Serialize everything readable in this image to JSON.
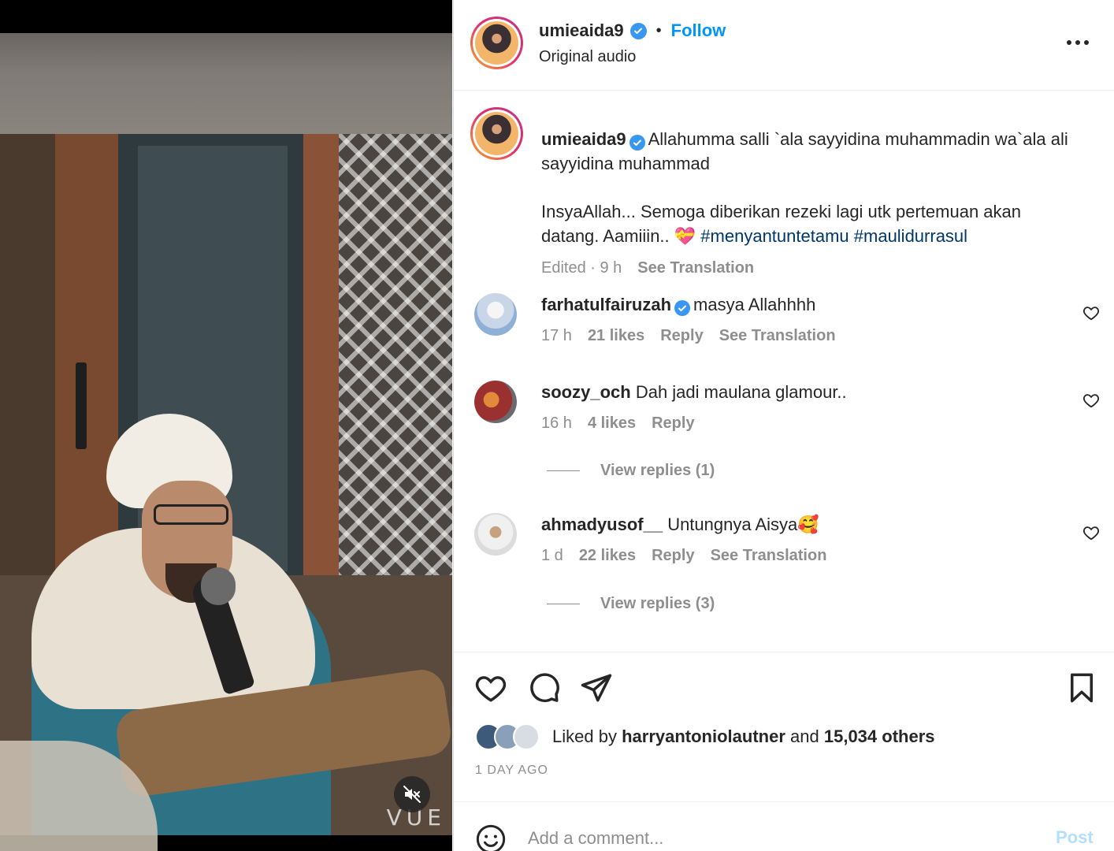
{
  "media": {
    "watermark": "VUE",
    "mute_icon": "speaker-muted-icon"
  },
  "header": {
    "username": "umieaida9",
    "verified_icon": "verified-badge-icon",
    "separator": "•",
    "follow_label": "Follow",
    "audio_label": "Original audio",
    "more_icon": "more-options-icon"
  },
  "caption": {
    "username": "umieaida9",
    "text_line1": "Allahumma salli `ala sayyidina muhammadin wa`ala ali sayyidina muhammad",
    "text_para2": "InsyaAllah... Semoga diberikan rezeki lagi utk pertemuan akan datang. Aamiiin.. 💝",
    "hashtag1": "#menyantuntetamu",
    "hashtag2": "#maulidurrasul",
    "edited": "Edited · 9 h",
    "see_translation": "See Translation"
  },
  "comments": [
    {
      "username": "farhatulfairuzah",
      "verified": true,
      "text": "masya Allahhhh",
      "time": "17 h",
      "likes": "21 likes",
      "reply": "Reply",
      "see_translation": "See Translation"
    },
    {
      "username": "soozy_och",
      "verified": false,
      "text": "Dah jadi maulana glamour..",
      "time": "16 h",
      "likes": "4 likes",
      "reply": "Reply",
      "view_replies": "View replies (1)"
    },
    {
      "username": "ahmadyusof__",
      "verified": false,
      "text": "Untungnya Aisya🥰",
      "time": "1 d",
      "likes": "22 likes",
      "reply": "Reply",
      "see_translation": "See Translation",
      "view_replies": "View replies (3)"
    }
  ],
  "actions": {
    "like_icon": "heart-icon",
    "comment_icon": "comment-bubble-icon",
    "share_icon": "paper-plane-icon",
    "save_icon": "bookmark-icon"
  },
  "likes": {
    "prefix": "Liked by",
    "user": "harryantoniolautner",
    "middle": "and",
    "others": "15,034 others"
  },
  "timestamp": "1 DAY AGO",
  "add_comment": {
    "placeholder": "Add a comment...",
    "post_label": "Post",
    "emoji_icon": "emoji-smiley-icon"
  },
  "colors": {
    "accent": "#0095f6",
    "hashtag": "#00376b",
    "muted": "#8e8e8e",
    "post_disabled": "#b2dffc",
    "verified": "#3897f0"
  }
}
